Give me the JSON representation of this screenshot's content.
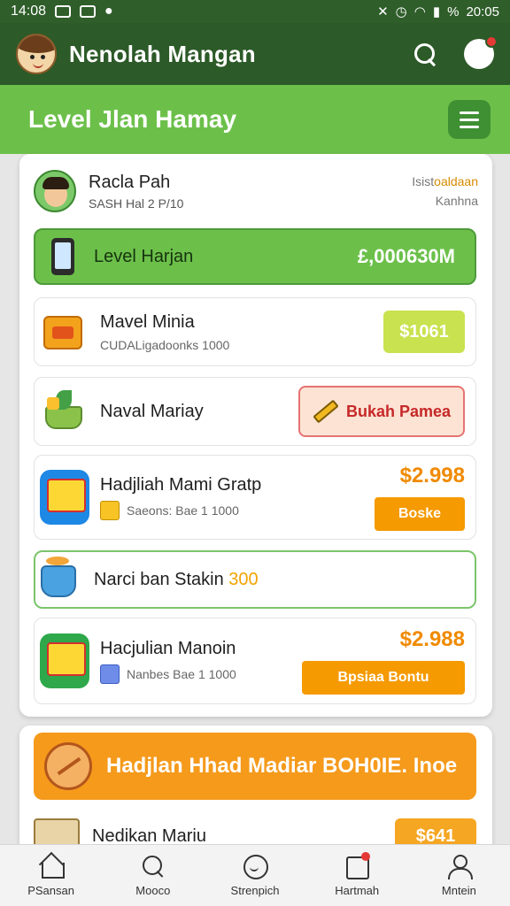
{
  "status_bar": {
    "time": "14:08",
    "battery": "%",
    "right_time": "20:05"
  },
  "app_bar": {
    "title": "Nenolah Mangan"
  },
  "banner": {
    "title": "Level Jlan Hamay"
  },
  "profile": {
    "name": "Racla Pah",
    "subtitle": "SASH Hal 2 P/10",
    "right_top_gray": "Isist",
    "right_top_highlight": "oaldaan",
    "right_bottom": "Kanhna"
  },
  "level_row": {
    "label": "Level Harjan",
    "value": "£,000630M"
  },
  "items": [
    {
      "name": "Mavel Minia",
      "subtitle": "CUDALigadoonks 1000",
      "button": "$1061"
    },
    {
      "name": "Naval Mariay",
      "button": "Bukah Pamea"
    },
    {
      "name": "Hadjliah Mami Gratp",
      "subtitle": "Saeons: Bae 1 1000",
      "price": "$2.998",
      "button": "Boske"
    },
    {
      "name": "Hacjulian Manoin",
      "subtitle": "Nanbes Bae 1 1000",
      "price": "$2.988",
      "button": "Bpsiaa Bontu"
    }
  ],
  "special_row": {
    "text": "Narci ban Stakin ",
    "highlight": "300"
  },
  "promo": {
    "banner_text": "Hadjlan Hhad Madiar BOH0IE. Inoe",
    "item_name": "Nedikan Mariu",
    "item_price": "$641"
  },
  "bottom_nav": [
    {
      "label": "PSansan",
      "icon": "home-icon"
    },
    {
      "label": "Mooco",
      "icon": "search-icon"
    },
    {
      "label": "Strenpich",
      "icon": "smile-icon"
    },
    {
      "label": "Hartmah",
      "icon": "notification-icon"
    },
    {
      "label": "Mntein",
      "icon": "user-icon"
    }
  ],
  "colors": {
    "app_bar": "#2c5a28",
    "banner": "#6cc04a",
    "accent_orange": "#f59a00",
    "price_orange": "#f08a00",
    "lime_button": "#c9e24f"
  }
}
